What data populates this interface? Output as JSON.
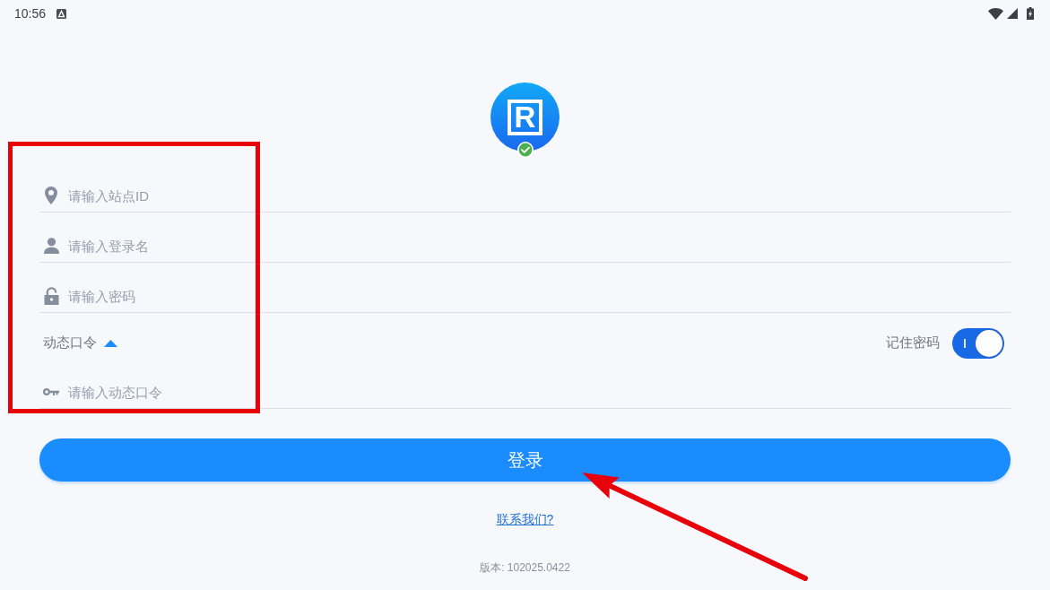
{
  "status_bar": {
    "time": "10:56"
  },
  "logo": {
    "letter": "R",
    "verified": true
  },
  "fields": [
    {
      "kind": "location",
      "placeholder": "请输入站点ID"
    },
    {
      "kind": "person",
      "placeholder": "请输入登录名"
    },
    {
      "kind": "lock",
      "placeholder": "请输入密码"
    }
  ],
  "dynamic_code": {
    "label": "动态口令",
    "expanded": true,
    "field": {
      "kind": "key",
      "placeholder": "请输入动态口令"
    }
  },
  "remember_password": {
    "label": "记住密码",
    "on": true
  },
  "login_button": {
    "label": "登录"
  },
  "contact_link": {
    "label": "联系我们?"
  },
  "version": "版本: 102025.0422",
  "annotations": [
    {
      "kind": "rectangle"
    },
    {
      "kind": "arrow"
    }
  ]
}
